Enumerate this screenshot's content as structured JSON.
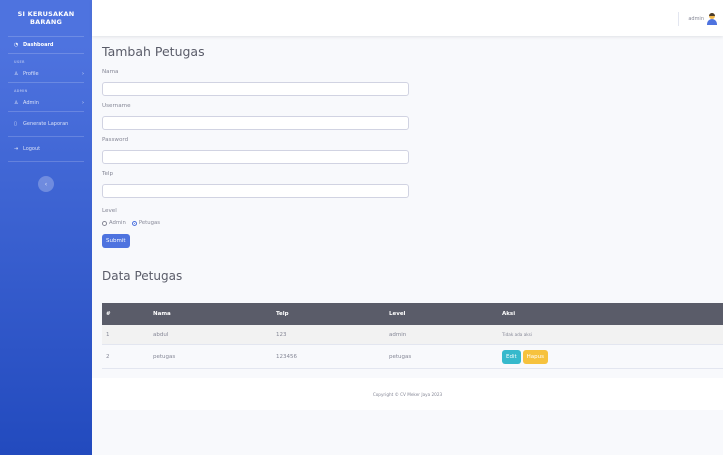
{
  "sidebar": {
    "brand_line1": "SI KERUSAKAN",
    "brand_line2": "BARANG",
    "dashboard": "Dashboard",
    "heading_user": "USER",
    "profile": "Profile",
    "heading_admin": "ADMIN",
    "admin": "Admin",
    "generate": "Generate Laporan",
    "logout": "Logout",
    "toggle": "‹"
  },
  "topbar": {
    "user_name": "admin"
  },
  "form": {
    "title": "Tambah Petugas",
    "nama_label": "Nama",
    "nama_value": "",
    "username_label": "Username",
    "username_value": "",
    "password_label": "Password",
    "password_value": "",
    "telp_label": "Telp",
    "telp_value": "",
    "level_label": "Level",
    "level_options": [
      "Admin",
      "Petugas"
    ],
    "level_selected": "Petugas",
    "submit": "Submit"
  },
  "table": {
    "title": "Data Petugas",
    "headers": [
      "#",
      "Nama",
      "Telp",
      "Level",
      "Aksi"
    ],
    "rows": [
      {
        "no": "1",
        "nama": "abdul",
        "telp": "123",
        "level": "admin",
        "aksi": "Tidak ada aksi"
      },
      {
        "no": "2",
        "nama": "petugas",
        "telp": "123456",
        "level": "petugas",
        "edit": "Edit",
        "hapus": "Hapus"
      }
    ]
  },
  "footer": {
    "text": "Copyright © CV Meker Jaya 2023"
  },
  "colors": {
    "primary": "#4e73df",
    "info": "#36b9cc",
    "warning": "#f6c23e",
    "table_head": "#5a5c69"
  }
}
